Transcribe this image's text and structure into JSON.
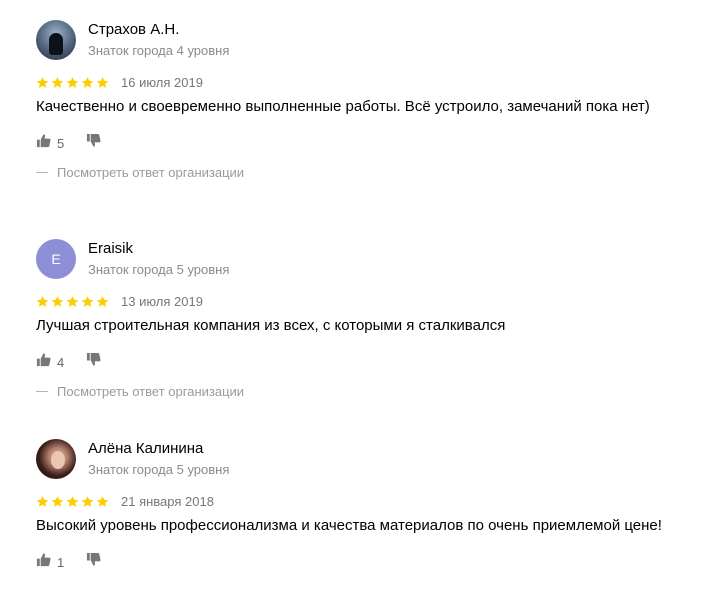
{
  "colors": {
    "star": "#fc0",
    "meta_text": "#8a8a8a",
    "avatar_letter_bg": "#8c8fd6"
  },
  "reviews": [
    {
      "author": "Страхов А.Н.",
      "level": "Знаток города 4 уровня",
      "avatar": "photo",
      "rating": 5,
      "date": "16 июля 2019",
      "text": "Качественно и своевременно выполненные работы. Всё устроило, замечаний пока нет)",
      "likes": "5",
      "reply_label": "Посмотреть ответ организации",
      "like_icon": "thumbs-up-icon",
      "dislike_icon": "thumbs-down-icon"
    },
    {
      "author": "Eraisik",
      "level": "Знаток города 5 уровня",
      "avatar": "letter",
      "avatar_letter": "E",
      "rating": 5,
      "date": "13 июля 2019",
      "text": "Лучшая строительная компания из всех, с которыми я сталкивался",
      "likes": "4",
      "reply_label": "Посмотреть ответ организации",
      "like_icon": "thumbs-up-icon",
      "dislike_icon": "thumbs-down-icon"
    },
    {
      "author": "Алёна Калинина",
      "level": "Знаток города 5 уровня",
      "avatar": "photo",
      "rating": 5,
      "date": "21 января 2018",
      "text": "Высокий уровень профессионализма и качества материалов по очень приемлемой цене!",
      "likes": "1",
      "like_icon": "thumbs-up-icon",
      "dislike_icon": "thumbs-down-icon"
    }
  ]
}
